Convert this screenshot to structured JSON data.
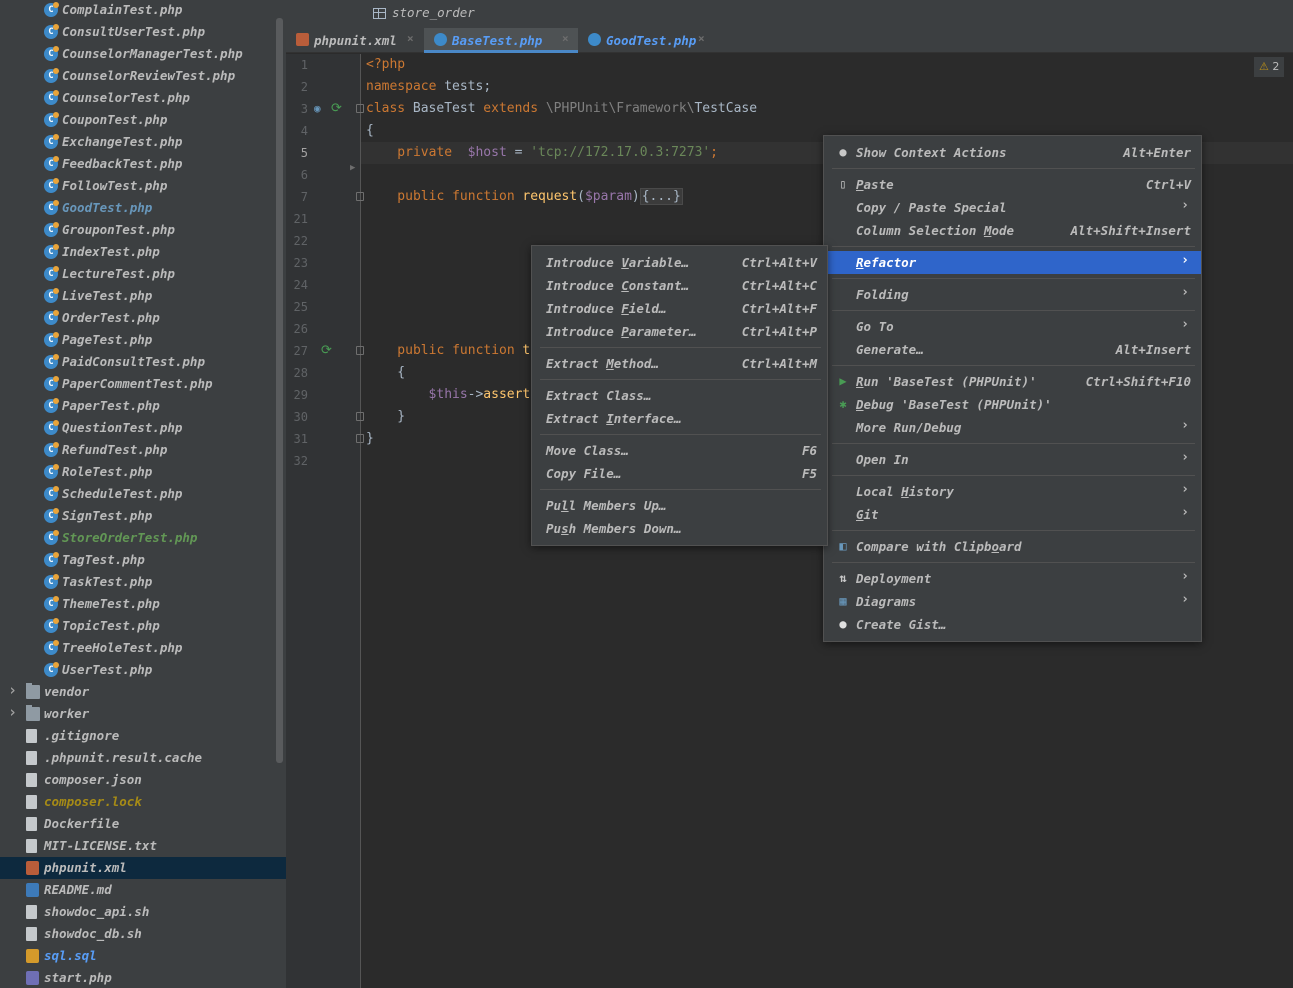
{
  "breadcrumb": {
    "text": "store_order",
    "icon": "table-icon"
  },
  "tabs": [
    {
      "label": "phpunit.xml",
      "icon": "xml-file-icon",
      "color": "#bbbbbb",
      "active": false
    },
    {
      "label": "BaseTest.php",
      "icon": "php-class-icon",
      "color": "#589df6",
      "active": true
    },
    {
      "label": "GoodTest.php",
      "icon": "php-class-icon",
      "color": "#589df6",
      "active": false
    }
  ],
  "tab_close": "×",
  "project_tree": {
    "items": [
      {
        "label": "ComplainTest.php",
        "icon": "php-class-icon",
        "color": "#bbbbbb"
      },
      {
        "label": "ConsultUserTest.php",
        "icon": "php-class-icon",
        "color": "#bbbbbb"
      },
      {
        "label": "CounselorManagerTest.php",
        "icon": "php-class-icon",
        "color": "#bbbbbb"
      },
      {
        "label": "CounselorReviewTest.php",
        "icon": "php-class-icon",
        "color": "#bbbbbb"
      },
      {
        "label": "CounselorTest.php",
        "icon": "php-class-icon",
        "color": "#bbbbbb"
      },
      {
        "label": "CouponTest.php",
        "icon": "php-class-icon",
        "color": "#bbbbbb"
      },
      {
        "label": "ExchangeTest.php",
        "icon": "php-class-icon",
        "color": "#bbbbbb"
      },
      {
        "label": "FeedbackTest.php",
        "icon": "php-class-icon",
        "color": "#bbbbbb"
      },
      {
        "label": "FollowTest.php",
        "icon": "php-class-icon",
        "color": "#bbbbbb"
      },
      {
        "label": "GoodTest.php",
        "icon": "php-class-icon",
        "color": "#6897bb"
      },
      {
        "label": "GrouponTest.php",
        "icon": "php-class-icon",
        "color": "#bbbbbb"
      },
      {
        "label": "IndexTest.php",
        "icon": "php-class-icon",
        "color": "#bbbbbb"
      },
      {
        "label": "LectureTest.php",
        "icon": "php-class-icon",
        "color": "#bbbbbb"
      },
      {
        "label": "LiveTest.php",
        "icon": "php-class-icon",
        "color": "#bbbbbb"
      },
      {
        "label": "OrderTest.php",
        "icon": "php-class-icon",
        "color": "#bbbbbb"
      },
      {
        "label": "PageTest.php",
        "icon": "php-class-icon",
        "color": "#bbbbbb"
      },
      {
        "label": "PaidConsultTest.php",
        "icon": "php-class-icon",
        "color": "#bbbbbb"
      },
      {
        "label": "PaperCommentTest.php",
        "icon": "php-class-icon",
        "color": "#bbbbbb"
      },
      {
        "label": "PaperTest.php",
        "icon": "php-class-icon",
        "color": "#bbbbbb"
      },
      {
        "label": "QuestionTest.php",
        "icon": "php-class-icon",
        "color": "#bbbbbb"
      },
      {
        "label": "RefundTest.php",
        "icon": "php-class-icon",
        "color": "#bbbbbb"
      },
      {
        "label": "RoleTest.php",
        "icon": "php-class-icon",
        "color": "#bbbbbb"
      },
      {
        "label": "ScheduleTest.php",
        "icon": "php-class-icon",
        "color": "#bbbbbb"
      },
      {
        "label": "SignTest.php",
        "icon": "php-class-icon",
        "color": "#bbbbbb"
      },
      {
        "label": "StoreOrderTest.php",
        "icon": "php-class-icon",
        "color": "#629755"
      },
      {
        "label": "TagTest.php",
        "icon": "php-class-icon",
        "color": "#bbbbbb"
      },
      {
        "label": "TaskTest.php",
        "icon": "php-class-icon",
        "color": "#bbbbbb"
      },
      {
        "label": "ThemeTest.php",
        "icon": "php-class-icon",
        "color": "#bbbbbb"
      },
      {
        "label": "TopicTest.php",
        "icon": "php-class-icon",
        "color": "#bbbbbb"
      },
      {
        "label": "TreeHoleTest.php",
        "icon": "php-class-icon",
        "color": "#bbbbbb"
      },
      {
        "label": "UserTest.php",
        "icon": "php-class-icon",
        "color": "#bbbbbb"
      },
      {
        "label": "vendor",
        "icon": "folder-icon",
        "color": "#bbbbbb",
        "expandable": true
      },
      {
        "label": "worker",
        "icon": "folder-icon",
        "color": "#bbbbbb",
        "expandable": true
      },
      {
        "label": ".gitignore",
        "icon": "text-file-icon",
        "color": "#bbbbbb"
      },
      {
        "label": ".phpunit.result.cache",
        "icon": "text-file-icon",
        "color": "#bbbbbb"
      },
      {
        "label": "composer.json",
        "icon": "json-file-icon",
        "color": "#bbbbbb"
      },
      {
        "label": "composer.lock",
        "icon": "lock-file-icon",
        "color": "#a68b16"
      },
      {
        "label": "Dockerfile",
        "icon": "docker-file-icon",
        "color": "#bbbbbb"
      },
      {
        "label": "MIT-LICENSE.txt",
        "icon": "text-file-icon",
        "color": "#bbbbbb"
      },
      {
        "label": "phpunit.xml",
        "icon": "xml-file-icon",
        "color": "#bbbbbb",
        "selected": true
      },
      {
        "label": "README.md",
        "icon": "markdown-file-icon",
        "color": "#bbbbbb"
      },
      {
        "label": "showdoc_api.sh",
        "icon": "shell-file-icon",
        "color": "#bbbbbb"
      },
      {
        "label": "showdoc_db.sh",
        "icon": "shell-file-icon",
        "color": "#bbbbbb"
      },
      {
        "label": "sql.sql",
        "icon": "sql-file-icon",
        "color": "#589df6"
      },
      {
        "label": "start.php",
        "icon": "php-file-icon",
        "color": "#bbbbbb"
      }
    ]
  },
  "editor": {
    "warning_count": "2",
    "warning_icon": "⚠",
    "line_numbers": [
      "1",
      "2",
      "3",
      "4",
      "5",
      "6",
      "7",
      "21",
      "22",
      "23",
      "24",
      "25",
      "26",
      "27",
      "28",
      "29",
      "30",
      "31",
      "32"
    ],
    "current_line": "5",
    "lines": [
      [
        {
          "t": "<?php",
          "c": "#cc7832"
        }
      ],
      [
        {
          "t": "namespace ",
          "c": "#cc7832"
        },
        {
          "t": "tests;",
          "c": "#a9b7c6"
        }
      ],
      [
        {
          "t": "class ",
          "c": "#cc7832"
        },
        {
          "t": "BaseTest ",
          "c": "#a9b7c6"
        },
        {
          "t": "extends ",
          "c": "#cc7832"
        },
        {
          "t": "\\PHPUnit\\Framework\\",
          "c": "#808080"
        },
        {
          "t": "TestCase",
          "c": "#a9b7c6"
        }
      ],
      [
        {
          "t": "{",
          "c": "#a9b7c6"
        }
      ],
      [
        {
          "t": "    private  ",
          "c": "#cc7832"
        },
        {
          "t": "$host",
          "c": "#9876aa"
        },
        {
          "t": " = ",
          "c": "#a9b7c6"
        },
        {
          "t": "'tcp://172.17.0.3:7273'",
          "c": "#6a8759"
        },
        {
          "t": ";",
          "c": "#cc7832"
        }
      ],
      [],
      [
        {
          "t": "    public function ",
          "c": "#cc7832"
        },
        {
          "t": "request",
          "c": "#ffc66d"
        },
        {
          "t": "(",
          "c": "#a9b7c6"
        },
        {
          "t": "$param",
          "c": "#9876aa"
        },
        {
          "t": ")",
          "c": "#a9b7c6"
        },
        {
          "t": "{...}",
          "c": "#a9b7c6",
          "box": true
        }
      ],
      [],
      [],
      [],
      [],
      [],
      [],
      [
        {
          "t": "    public function ",
          "c": "#cc7832"
        },
        {
          "t": "t",
          "c": "#ffc66d"
        }
      ],
      [
        {
          "t": "    {",
          "c": "#a9b7c6"
        }
      ],
      [
        {
          "t": "        ",
          "c": "#a9b7c6"
        },
        {
          "t": "$this",
          "c": "#9876aa"
        },
        {
          "t": "->",
          "c": "#a9b7c6"
        },
        {
          "t": "assert",
          "c": "#ffc66d"
        }
      ],
      [
        {
          "t": "    }",
          "c": "#a9b7c6"
        }
      ],
      [
        {
          "t": "}",
          "c": "#a9b7c6"
        }
      ],
      []
    ]
  },
  "context_menu": {
    "items": [
      {
        "label": "Show Context Actions",
        "shortcut": "Alt+Enter",
        "icon": "lightbulb-icon",
        "name": "show-context-actions"
      },
      {
        "sep": true
      },
      {
        "label": "Paste",
        "u": "P",
        "shortcut": "Ctrl+V",
        "icon": "clipboard-icon",
        "name": "paste"
      },
      {
        "label": "Copy / Paste Special",
        "submenu": true,
        "name": "copy-paste-special"
      },
      {
        "label": "Column Selection Mode",
        "u": "M",
        "uidx": 17,
        "shortcut": "Alt+Shift+Insert",
        "name": "column-selection-mode"
      },
      {
        "sep": true
      },
      {
        "label": "Refactor",
        "u": "R",
        "submenu": true,
        "selected": true,
        "name": "refactor"
      },
      {
        "sep": true
      },
      {
        "label": "Folding",
        "submenu": true,
        "name": "folding"
      },
      {
        "sep": true
      },
      {
        "label": "Go To",
        "submenu": true,
        "name": "go-to"
      },
      {
        "label": "Generate…",
        "shortcut": "Alt+Insert",
        "name": "generate"
      },
      {
        "sep": true
      },
      {
        "label": "Run 'BaseTest (PHPUnit)'",
        "u": "R",
        "shortcut": "Ctrl+Shift+F10",
        "icon": "run-icon",
        "name": "run-basetest"
      },
      {
        "label": "Debug 'BaseTest (PHPUnit)'",
        "u": "D",
        "icon": "debug-icon",
        "name": "debug-basetest"
      },
      {
        "label": "More Run/Debug",
        "submenu": true,
        "name": "more-run-debug"
      },
      {
        "sep": true
      },
      {
        "label": "Open In",
        "submenu": true,
        "name": "open-in"
      },
      {
        "sep": true
      },
      {
        "label": "Local History",
        "u": "H",
        "uidx": 6,
        "submenu": true,
        "name": "local-history"
      },
      {
        "label": "Git",
        "u": "G",
        "submenu": true,
        "name": "git"
      },
      {
        "sep": true
      },
      {
        "label": "Compare with Clipboard",
        "u": "b",
        "uidx": 18,
        "icon": "compare-icon",
        "name": "compare-with-clipboard"
      },
      {
        "sep": true
      },
      {
        "label": "Deployment",
        "submenu": true,
        "icon": "deployment-icon",
        "name": "deployment"
      },
      {
        "label": "Diagrams",
        "submenu": true,
        "icon": "diagram-icon",
        "name": "diagrams"
      },
      {
        "label": "Create Gist…",
        "icon": "github-icon",
        "name": "create-gist"
      }
    ]
  },
  "refactor_menu": {
    "items": [
      {
        "label": "Introduce Variable…",
        "u": "V",
        "uidx": 10,
        "shortcut": "Ctrl+Alt+V",
        "name": "introduce-variable"
      },
      {
        "label": "Introduce Constant…",
        "u": "C",
        "uidx": 10,
        "shortcut": "Ctrl+Alt+C",
        "name": "introduce-constant"
      },
      {
        "label": "Introduce Field…",
        "u": "F",
        "uidx": 10,
        "shortcut": "Ctrl+Alt+F",
        "name": "introduce-field"
      },
      {
        "label": "Introduce Parameter…",
        "u": "P",
        "uidx": 10,
        "shortcut": "Ctrl+Alt+P",
        "name": "introduce-parameter"
      },
      {
        "sep": true
      },
      {
        "label": "Extract Method…",
        "u": "M",
        "uidx": 8,
        "shortcut": "Ctrl+Alt+M",
        "name": "extract-method"
      },
      {
        "sep": true
      },
      {
        "label": "Extract Class…",
        "name": "extract-class"
      },
      {
        "label": "Extract Interface…",
        "u": "I",
        "uidx": 8,
        "name": "extract-interface"
      },
      {
        "sep": true
      },
      {
        "label": "Move Class…",
        "shortcut": "F6",
        "name": "move-class"
      },
      {
        "label": "Copy File…",
        "shortcut": "F5",
        "name": "copy-file"
      },
      {
        "sep": true
      },
      {
        "label": "Pull Members Up…",
        "u": "l",
        "uidx": 2,
        "name": "pull-members-up"
      },
      {
        "label": "Push Members Down…",
        "u": "s",
        "uidx": 2,
        "name": "push-members-down"
      }
    ]
  },
  "colors": {
    "accent": "#2f65ca",
    "tab_underline": "#4a88c7",
    "selection": "#0d293e"
  }
}
